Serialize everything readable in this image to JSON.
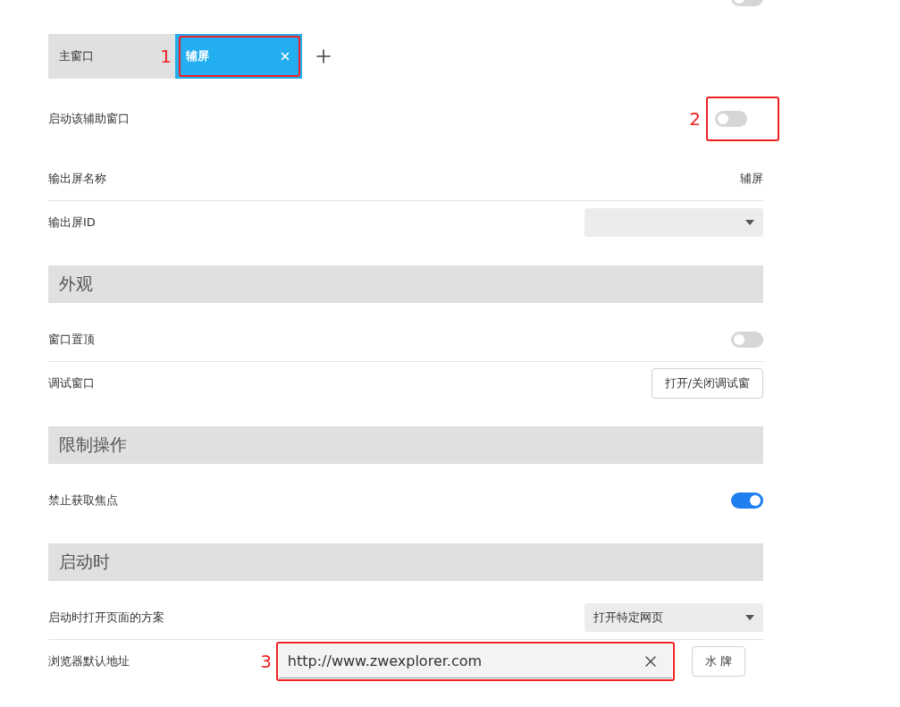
{
  "top_toggle": {
    "on": false
  },
  "tabs": [
    {
      "label": "主窗口",
      "selected": false,
      "closable": false
    },
    {
      "label": "辅屏",
      "selected": true,
      "closable": true,
      "annotation": "1"
    }
  ],
  "enable_row": {
    "label": "启动该辅助窗口",
    "on": false,
    "annotation": "2"
  },
  "groups": [
    {
      "rows": [
        {
          "kind": "text",
          "label": "输出屏名称",
          "value": "辅屏"
        },
        {
          "kind": "select",
          "label": "输出屏ID"
        }
      ]
    },
    {
      "heading": "外观",
      "rows": [
        {
          "kind": "toggle",
          "label": "窗口置顶",
          "on": false
        },
        {
          "kind": "button",
          "label": "调试窗口",
          "button": "打开/关闭调试窗"
        }
      ]
    },
    {
      "heading": "限制操作",
      "rows": [
        {
          "kind": "toggle",
          "label": "禁止获取焦点",
          "on": true
        }
      ]
    },
    {
      "heading": "启动时",
      "rows": [
        {
          "kind": "select",
          "label": "启动时打开页面的方案",
          "value": "打开特定网页"
        },
        {
          "kind": "url",
          "label": "浏览器默认地址",
          "value": "http://www.zwexplorer.com",
          "button": "水 牌",
          "annotation": "3"
        }
      ]
    }
  ]
}
